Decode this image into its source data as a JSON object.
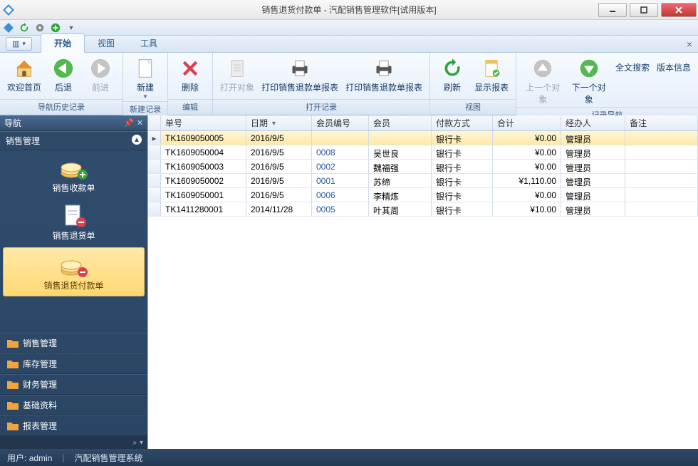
{
  "window": {
    "title": "销售退货付款单 - 汽配销售管理软件[试用版本]"
  },
  "tabs": {
    "file": "▥ ▾",
    "start": "开始",
    "view": "视图",
    "tools": "工具"
  },
  "ribbon": {
    "welcome": "欢迎首页",
    "back": "后退",
    "forward": "前进",
    "new": "新建",
    "delete": "删除",
    "open_obj": "打开对象",
    "print_refund": "打印销售退款单报表",
    "print_return": "打印销售退款单报表",
    "refresh": "刷新",
    "show_report": "显示报表",
    "prev_obj": "上一个对象",
    "next_obj": "下一个对象",
    "fulltext": "全文搜索",
    "version": "版本信息",
    "grp_nav": "导航历史记录",
    "grp_new": "新建记录",
    "grp_edit": "编辑",
    "grp_open": "打开记录",
    "grp_view": "视图",
    "grp_recnav": "记录导航"
  },
  "sidebar": {
    "title": "导航",
    "section": "销售管理",
    "items": [
      {
        "label": "销售收款单"
      },
      {
        "label": "销售退货单"
      },
      {
        "label": "销售退货付款单"
      }
    ],
    "cats": [
      "销售管理",
      "库存管理",
      "财务管理",
      "基础资料",
      "报表管理"
    ]
  },
  "grid": {
    "cols": {
      "order": "单号",
      "date": "日期",
      "memno": "会员编号",
      "mem": "会员",
      "pay": "付款方式",
      "total": "合计",
      "op": "经办人",
      "note": "备注"
    },
    "rows": [
      {
        "order": "TK1609050005",
        "date": "2016/9/5",
        "memno": "",
        "mem": "",
        "pay": "银行卡",
        "total": "¥0.00",
        "op": "管理员",
        "note": ""
      },
      {
        "order": "TK1609050004",
        "date": "2016/9/5",
        "memno": "0008",
        "mem": "吴世良",
        "pay": "银行卡",
        "total": "¥0.00",
        "op": "管理员",
        "note": ""
      },
      {
        "order": "TK1609050003",
        "date": "2016/9/5",
        "memno": "0002",
        "mem": "魏福强",
        "pay": "银行卡",
        "total": "¥0.00",
        "op": "管理员",
        "note": ""
      },
      {
        "order": "TK1609050002",
        "date": "2016/9/5",
        "memno": "0001",
        "mem": "苏缔",
        "pay": "银行卡",
        "total": "¥1,110.00",
        "op": "管理员",
        "note": ""
      },
      {
        "order": "TK1609050001",
        "date": "2016/9/5",
        "memno": "0006",
        "mem": "李精炼",
        "pay": "银行卡",
        "total": "¥0.00",
        "op": "管理员",
        "note": ""
      },
      {
        "order": "TK1411280001",
        "date": "2014/11/28",
        "memno": "0005",
        "mem": "叶其周",
        "pay": "银行卡",
        "total": "¥10.00",
        "op": "管理员",
        "note": ""
      }
    ]
  },
  "status": {
    "user_label": "用户:",
    "user": "admin",
    "system": "汽配销售管理系统"
  }
}
